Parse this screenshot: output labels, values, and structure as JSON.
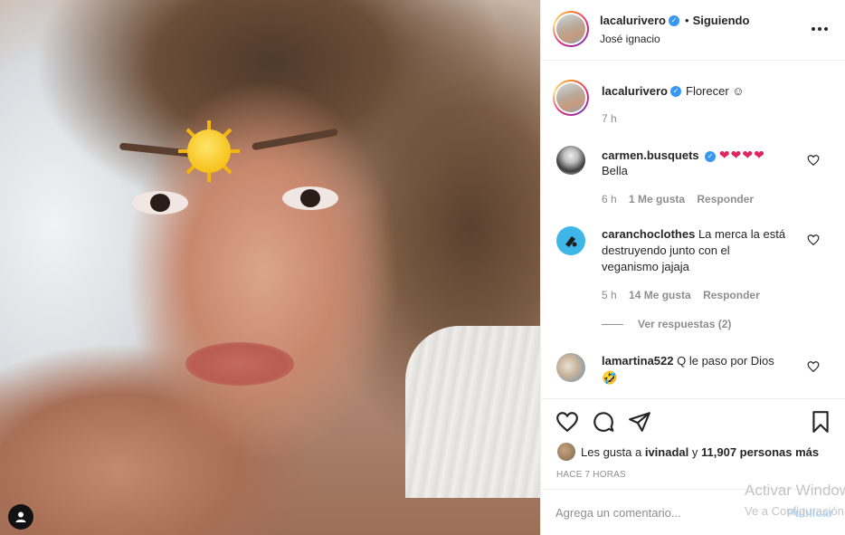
{
  "post": {
    "photo_alt": "selfie",
    "sun_emoji": "🌞"
  },
  "header": {
    "username": "lacalurivero",
    "verified_icon": "verified-badge-icon",
    "separator": "•",
    "following_label": "Siguiendo",
    "location": "José ignacio"
  },
  "caption": {
    "username": "lacalurivero",
    "text": "Florecer ☺",
    "time": "7 h"
  },
  "comments": [
    {
      "username": "carmen.busquets",
      "text_hearts": "❤❤❤❤",
      "text": "Bella",
      "time": "6 h",
      "likes": "1 Me gusta",
      "reply": "Responder"
    },
    {
      "username": "caranchoclothes",
      "text_line1": "La merca la está",
      "text_line2": "destruyendo junto con el",
      "text_line3": "veganismo jajaja",
      "time": "5 h",
      "likes": "14 Me gusta",
      "reply": "Responder"
    },
    {
      "username": "lamartina522",
      "text": "Q le paso por Dios",
      "emoji": "🤣"
    }
  ],
  "view_replies": "Ver respuestas (2)",
  "likes": {
    "prefix": "Les gusta a",
    "user": "ivinadal",
    "mid": "y",
    "count": "11,907 personas más"
  },
  "time_ago": "HACE 7 HORAS",
  "comment_input": {
    "placeholder": "Agrega un comentario...",
    "publish": "Publicar"
  },
  "watermark": {
    "line1": "Activar Windows",
    "line2": "Ve a Configuración"
  }
}
